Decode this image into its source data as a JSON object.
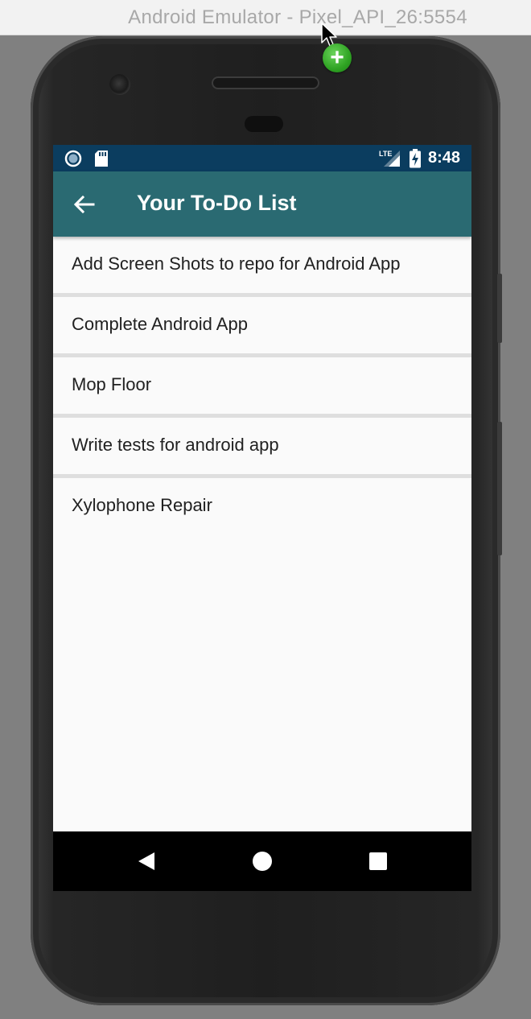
{
  "window": {
    "title": "Android Emulator - Pixel_API_26:5554"
  },
  "status_bar": {
    "time": "8:48",
    "network_label": "LTE",
    "icons": [
      "circle-notification-icon",
      "sd-card-icon",
      "lte-signal-icon",
      "battery-charging-icon"
    ]
  },
  "app_bar": {
    "title": "Your To-Do List",
    "back_icon": "arrow-left-icon",
    "background_color": "#2a6a72"
  },
  "todo_list": {
    "items": [
      {
        "text": "Add Screen Shots to repo  for Android App"
      },
      {
        "text": "Complete Android App"
      },
      {
        "text": "Mop Floor"
      },
      {
        "text": "Write tests for android app"
      },
      {
        "text": "Xylophone Repair"
      }
    ]
  },
  "nav_bar": {
    "icons": [
      "nav-back-icon",
      "nav-home-icon",
      "nav-recents-icon"
    ]
  },
  "colors": {
    "status_bar": "#0b3d5f",
    "app_bar": "#2a6a72",
    "list_background": "#fafafa",
    "divider": "#dedede",
    "nav_bar": "#000000"
  }
}
